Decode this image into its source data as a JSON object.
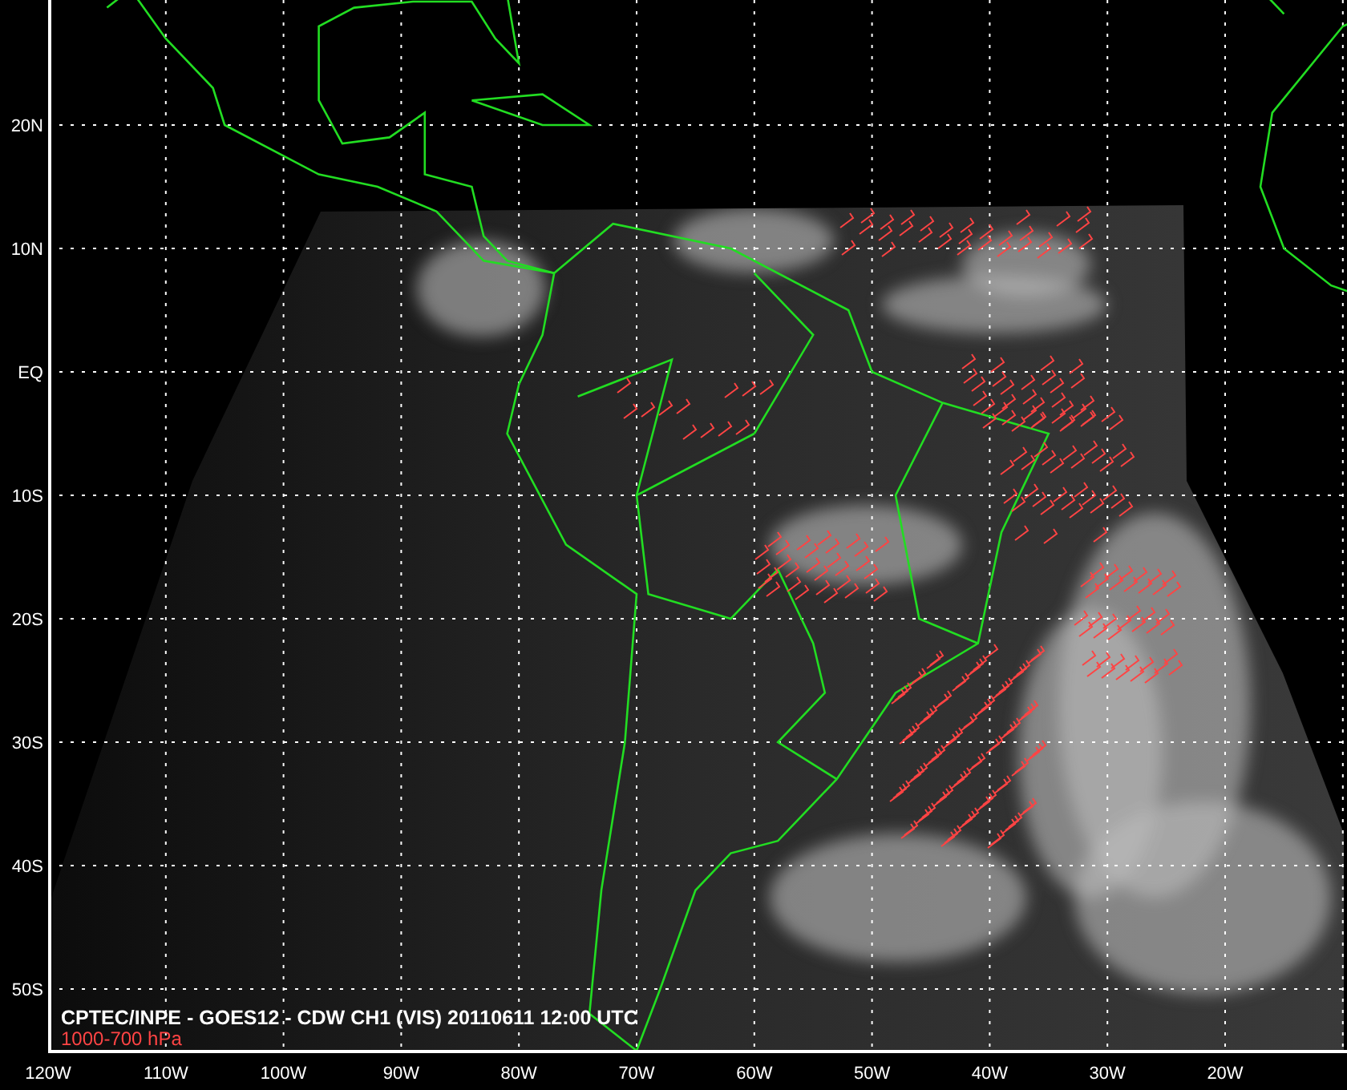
{
  "map": {
    "title": "CPTEC/INPE - GOES12 - CDW CH1 (VIS) 20110611 12:00 UTC",
    "subtitle": "1000-700 hPa",
    "lat_labels": [
      "20N",
      "10N",
      "EQ",
      "10S",
      "20S",
      "30S",
      "40S",
      "50S"
    ],
    "lon_labels": [
      "120W",
      "110W",
      "100W",
      "90W",
      "80W",
      "70W",
      "60W",
      "50W",
      "40W",
      "30W",
      "20W"
    ]
  }
}
